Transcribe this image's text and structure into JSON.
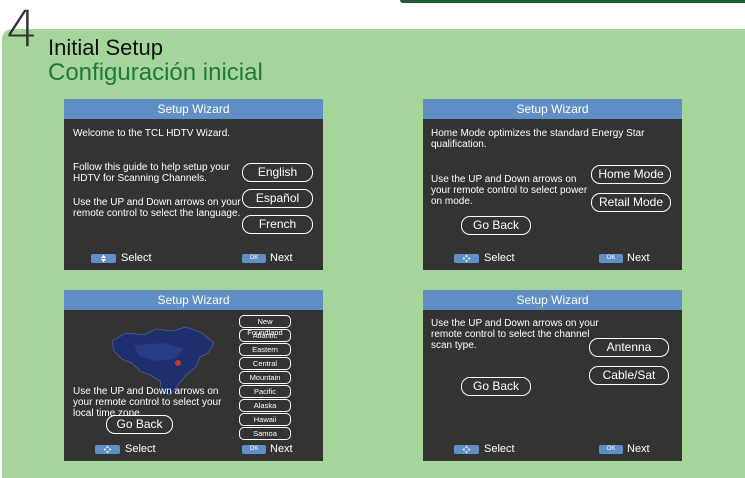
{
  "step": "4",
  "title_en": "Initial Setup",
  "title_es": "Configuración inicial",
  "colors": {
    "panel": "#a6d59c",
    "screen": "#333333",
    "header": "#5f8fc5",
    "title_es": "#1e7a3a"
  },
  "footer": {
    "select": "Select",
    "next": "Next",
    "ok": "OK"
  },
  "screens": {
    "s1": {
      "header": "Setup Wizard",
      "line1": "Welcome to the TCL HDTV Wizard.",
      "line2": "Follow this guide to help setup your HDTV for Scanning Channels.",
      "line3": "Use the UP and Down arrows on your remote control to select the language.",
      "buttons": [
        "English",
        "Español",
        "French"
      ]
    },
    "s2": {
      "header": "Setup Wizard",
      "line1": "Home Mode optimizes the standard Energy Star qualification.",
      "line2": "Use the UP and Down arrows on your remote control to select power on mode.",
      "buttons": [
        "Home Mode",
        "Retail Mode"
      ],
      "back": "Go Back"
    },
    "s3": {
      "header": "Setup Wizard",
      "line1": "Use the UP and Down arrows on your remote control to select your local time zone.",
      "zones": [
        "New Foundland",
        "Atlantic",
        "Eastern",
        "Central",
        "Mountain",
        "Pacific",
        "Alaska",
        "Hawaii",
        "Samoa"
      ],
      "back": "Go Back"
    },
    "s4": {
      "header": "Setup Wizard",
      "line1": "Use the UP and Down arrows on your remote control to select the channel scan type.",
      "buttons": [
        "Antenna",
        "Cable/Sat"
      ],
      "back": "Go Back"
    }
  }
}
